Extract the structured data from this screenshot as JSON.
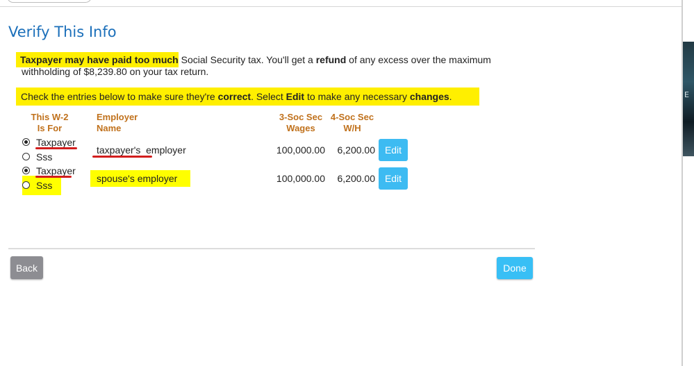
{
  "page": {
    "title": "Verify This Info"
  },
  "intro": {
    "lead_bold": "Taxpayer may have paid too much",
    "part2": " Social Security tax. You'll get a ",
    "refund_bold": "refund",
    "part3": " of any excess over the maximum withholding of $8,239.80 on your tax return."
  },
  "instruction": {
    "part1": "Check the entries below to make sure they're ",
    "correct_bold": "correct",
    "part2": ". Select ",
    "edit_bold": "Edit",
    "part3": " to make any necessary ",
    "changes_bold": "changes",
    "part4": "."
  },
  "table": {
    "headers": {
      "w2_line1": "This W-2",
      "w2_line2": "Is For",
      "employer_line1": "Employer",
      "employer_line2": "Name",
      "wages_line1": "3-Soc Sec",
      "wages_line2": "Wages",
      "wh_line1": "4-Soc Sec",
      "wh_line2": "W/H"
    },
    "rows": [
      {
        "option_taxpayer": "Taxpayer",
        "option_spouse": "Sss",
        "selected": "Taxpayer",
        "employer": "taxpayer's  employer",
        "wages": "100,000.00",
        "withholding": "6,200.00",
        "edit_label": "Edit"
      },
      {
        "option_taxpayer": "Taxpayer",
        "option_spouse": "Sss",
        "selected": "Taxpayer",
        "employer": "spouse's employer",
        "wages": "100,000.00",
        "withholding": "6,200.00",
        "edit_label": "Edit"
      }
    ]
  },
  "footer": {
    "back_label": "Back",
    "done_label": "Done"
  },
  "colors": {
    "title": "#1b6fba",
    "header": "#c0711c",
    "highlight": "#ffff00",
    "annotation": "#d21e1e",
    "primary_button": "#38bff5",
    "secondary_button": "#8d8d92"
  }
}
